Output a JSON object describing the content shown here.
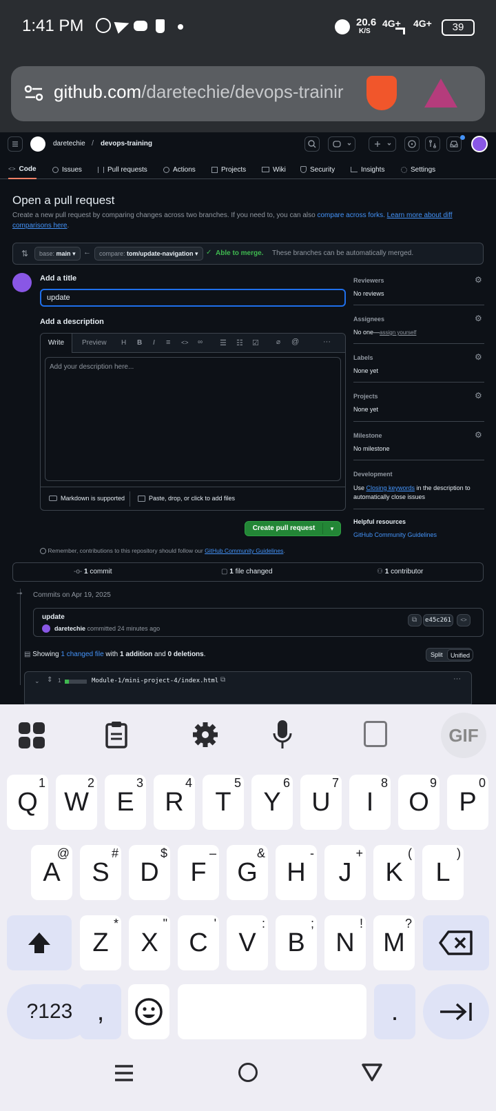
{
  "status": {
    "time": "1:41 PM",
    "speed": "20.6",
    "speed_unit": "K/S",
    "net1": "4G+",
    "net2": "4G+",
    "battery": "39"
  },
  "browser": {
    "url_host": "github.com",
    "url_path": "/daretechie/devops-trainir"
  },
  "header": {
    "owner": "daretechie",
    "sep": "/",
    "repo": "devops-training"
  },
  "tabs": [
    "Code",
    "Issues",
    "Pull requests",
    "Actions",
    "Projects",
    "Wiki",
    "Security",
    "Insights",
    "Settings"
  ],
  "page": {
    "title": "Open a pull request",
    "desc_prefix": "Create a new pull request by comparing changes across two branches. If you need to, you can also ",
    "desc_link1": "compare across forks.",
    "desc_link2": "Learn more about diff comparisons here",
    "desc_suffix": "."
  },
  "compare": {
    "base_label": "base:",
    "base_value": "main",
    "compare_label": "compare:",
    "compare_value": "tom/update-navigation",
    "merge_status": "Able to merge.",
    "merge_note": "These branches can be automatically merged."
  },
  "form": {
    "title_label": "Add a title",
    "title_value": "update",
    "desc_label": "Add a description",
    "tab_write": "Write",
    "tab_preview": "Preview",
    "placeholder": "Add your description here...",
    "markdown_note": "Markdown is supported",
    "attach_note": "Paste, drop, or click to add files",
    "submit": "Create pull request",
    "reminder": "Remember, contributions to this repository should follow our ",
    "reminder_link": "GitHub Community Guidelines",
    "reminder_end": "."
  },
  "sidebar": {
    "reviewers_title": "Reviewers",
    "reviewers_val": "No reviews",
    "assignees_title": "Assignees",
    "assignees_val": "No one—",
    "assignees_link": "assign yourself",
    "labels_title": "Labels",
    "labels_val": "None yet",
    "projects_title": "Projects",
    "projects_val": "None yet",
    "milestone_title": "Milestone",
    "milestone_val": "No milestone",
    "dev_title": "Development",
    "dev_pre": "Use ",
    "dev_link": "Closing keywords",
    "dev_post": " in the description to automatically close issues",
    "help_title": "Helpful resources",
    "help_link": "GitHub Community Guidelines"
  },
  "summary": {
    "commits_n": "1",
    "commits_l": "commit",
    "files_n": "1",
    "files_l": "file changed",
    "contrib_n": "1",
    "contrib_l": "contributor"
  },
  "commits": {
    "date": "Commits on Apr 19, 2025",
    "message": "update",
    "author": "daretechie",
    "meta": "committed 24 minutes ago",
    "sha": "e45c261"
  },
  "diff": {
    "showing": "Showing ",
    "changed": "1 changed file",
    "with": " with ",
    "additions": "1 addition",
    "and": " and ",
    "deletions": "0 deletions",
    "end": ".",
    "split": "Split",
    "unified": "Unified",
    "file_count": "1",
    "file_path": "Module-1/mini-project-4/index.html"
  },
  "keyboard": {
    "row1": [
      {
        "k": "Q",
        "s": "1"
      },
      {
        "k": "W",
        "s": "2"
      },
      {
        "k": "E",
        "s": "3"
      },
      {
        "k": "R",
        "s": "4"
      },
      {
        "k": "T",
        "s": "5"
      },
      {
        "k": "Y",
        "s": "6"
      },
      {
        "k": "U",
        "s": "7"
      },
      {
        "k": "I",
        "s": "8"
      },
      {
        "k": "O",
        "s": "9"
      },
      {
        "k": "P",
        "s": "0"
      }
    ],
    "row2": [
      {
        "k": "A",
        "s": "@"
      },
      {
        "k": "S",
        "s": "#"
      },
      {
        "k": "D",
        "s": "$"
      },
      {
        "k": "F",
        "s": "–"
      },
      {
        "k": "G",
        "s": "&"
      },
      {
        "k": "H",
        "s": "-"
      },
      {
        "k": "J",
        "s": "+"
      },
      {
        "k": "K",
        "s": "("
      },
      {
        "k": "L",
        "s": ")"
      }
    ],
    "row3": [
      {
        "k": "Z",
        "s": "*"
      },
      {
        "k": "X",
        "s": "\""
      },
      {
        "k": "C",
        "s": "'"
      },
      {
        "k": "V",
        "s": ":"
      },
      {
        "k": "B",
        "s": ";"
      },
      {
        "k": "N",
        "s": "!"
      },
      {
        "k": "M",
        "s": "?"
      }
    ],
    "sym": "?123",
    "comma": ",",
    "period": ".",
    "gif": "GIF"
  }
}
